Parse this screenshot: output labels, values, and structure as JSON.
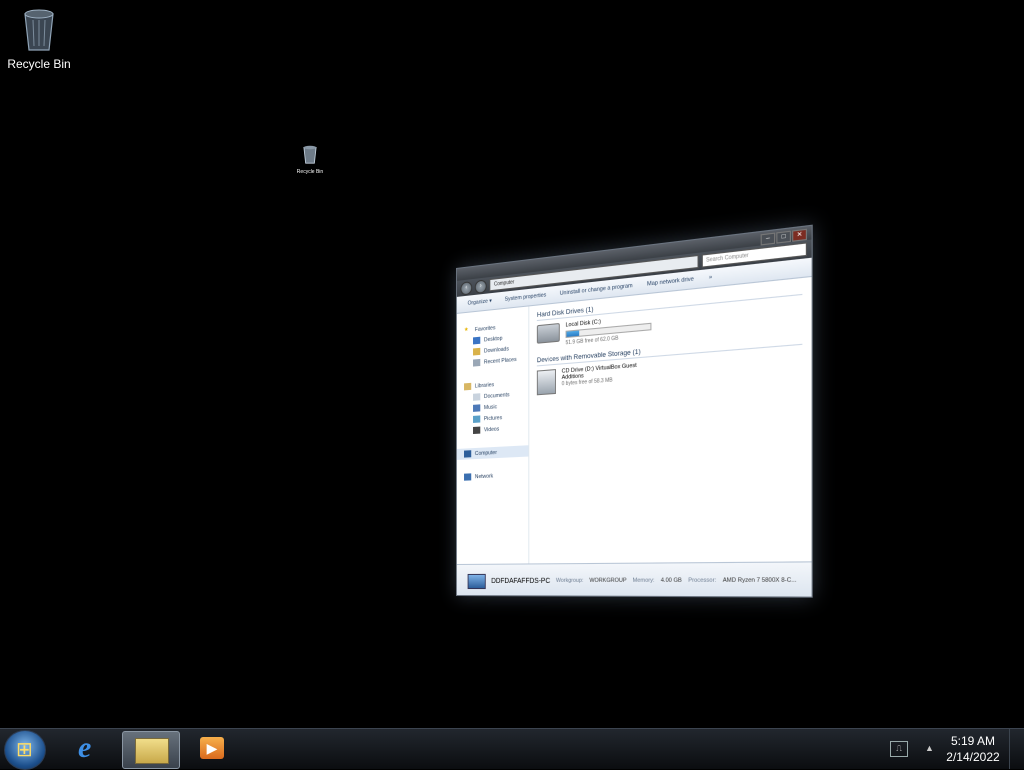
{
  "desktop": {
    "icons": [
      {
        "label": "Recycle Bin"
      }
    ],
    "preview_icon": {
      "label": "Recycle Bin"
    }
  },
  "window": {
    "address": "Computer",
    "search_placeholder": "Search Computer",
    "caption_buttons": [
      "–",
      "□",
      "✕"
    ],
    "toolbar": {
      "organize": "Organize ▾",
      "system_properties": "System properties",
      "uninstall": "Uninstall or change a program",
      "map_drive": "Map network drive",
      "more": "»"
    },
    "nav": {
      "favorites": "Favorites",
      "desktop": "Desktop",
      "downloads": "Downloads",
      "recent": "Recent Places",
      "libraries": "Libraries",
      "documents": "Documents",
      "music": "Music",
      "pictures": "Pictures",
      "videos": "Videos",
      "computer": "Computer",
      "network": "Network"
    },
    "sections": {
      "hdd": "Hard Disk Drives (1)",
      "removable": "Devices with Removable Storage (1)"
    },
    "local_disk": {
      "name": "Local Disk (C:)",
      "free": "51.9 GB free of 62.0 GB",
      "used_fraction": 0.16
    },
    "cd_drive": {
      "name": "CD Drive (D:) VirtualBox Guest Additions",
      "free": "0 bytes free of 58.3 MB"
    },
    "details": {
      "pc_name": "DDFDAFAFFDS-PC",
      "workgroup_label": "Workgroup:",
      "workgroup": "WORKGROUP",
      "memory_label": "Memory:",
      "memory": "4.00 GB",
      "processor_label": "Processor:",
      "processor": "AMD Ryzen 7 5800X 8-C..."
    }
  },
  "taskbar": {
    "clock_time": "5:19 AM",
    "clock_date": "2/14/2022"
  }
}
